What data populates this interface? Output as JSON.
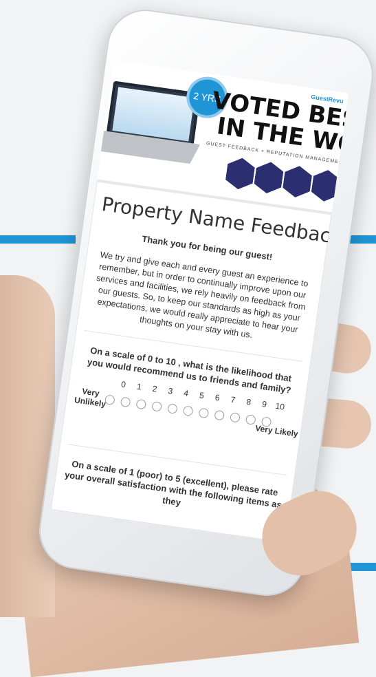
{
  "banner": {
    "badge": "2 YRS",
    "brand": "GuestRevu",
    "headline_1": "VOTED BEST",
    "headline_2": "IN THE WORLD",
    "tagline": "GUEST FEEDBACK + REPUTATION MANAGEMENT SOFTWARE"
  },
  "page": {
    "title": "Property Name Feedback",
    "subtitle": "Thank you for being our guest!",
    "intro": "We try and give each and every guest an experience to remember, but in order to continually improve upon our services and facilities, we rely heavily on feedback from our guests. So, to keep our standards as high as your expectations, we would really appreciate to hear your thoughts on your stay with us."
  },
  "question1": {
    "text": "On a scale of 0 to 10 , what is the likelihood that you would recommend us to friends and family?",
    "scale": [
      "0",
      "1",
      "2",
      "3",
      "4",
      "5",
      "6",
      "7",
      "8",
      "9",
      "10"
    ],
    "low_label": "Very Unlikely",
    "high_label": "Very Likely"
  },
  "question2": {
    "text": "On a scale of 1 (poor) to 5 (excellent), please rate your overall satisfaction with the following items as they"
  },
  "colors": {
    "accent": "#1f95d6",
    "award": "#2c2f6f"
  }
}
